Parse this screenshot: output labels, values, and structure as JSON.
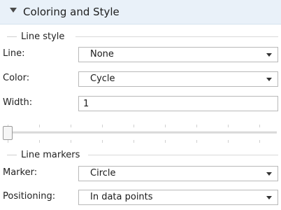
{
  "section": {
    "title": "Coloring and Style",
    "icon": "collapse-triangle-icon"
  },
  "line_style": {
    "legend": "Line style",
    "line": {
      "label": "Line:",
      "value": "None"
    },
    "color": {
      "label": "Color:",
      "value": "Cycle"
    },
    "width": {
      "label": "Width:",
      "value": "1"
    },
    "slider": {
      "position_fraction": 0.0
    }
  },
  "line_markers": {
    "legend": "Line markers",
    "marker": {
      "label": "Marker:",
      "value": "Circle"
    },
    "positioning": {
      "label": "Positioning:",
      "value": "In data points"
    }
  },
  "colors": {
    "header_bg": "#e9f1f9",
    "border": "#b9b9b9"
  }
}
